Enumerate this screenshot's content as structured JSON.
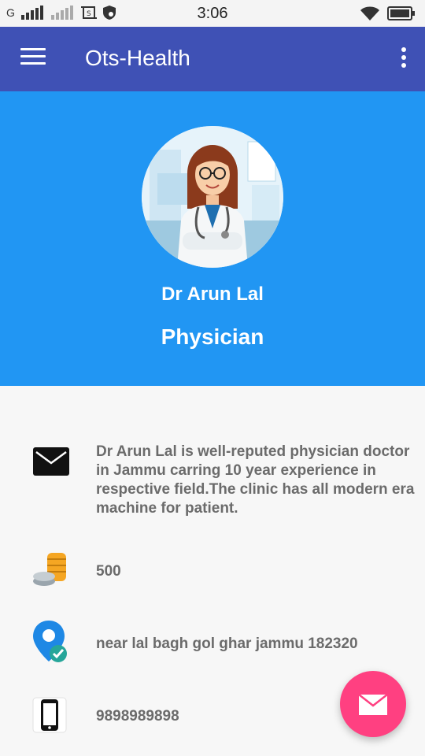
{
  "status_bar": {
    "network_type": "G",
    "time": "3:06"
  },
  "app_bar": {
    "title": "Ots-Health",
    "menu_icon": "hamburger-menu-icon",
    "overflow_icon": "more-vert-icon",
    "color": "#3f51b5"
  },
  "profile": {
    "name": "Dr Arun Lal",
    "specialty": "Physician",
    "header_color": "#2196f3"
  },
  "details": {
    "description": "Dr Arun Lal is well-reputed physician doctor in Jammu carring 10 year experience in respective field.The clinic has all modern era machine for patient.",
    "fee": "500",
    "address": "near lal bagh gol ghar jammu 182320",
    "phone": "9898989898"
  },
  "fab": {
    "icon": "mail-icon",
    "color": "#ff4081"
  }
}
